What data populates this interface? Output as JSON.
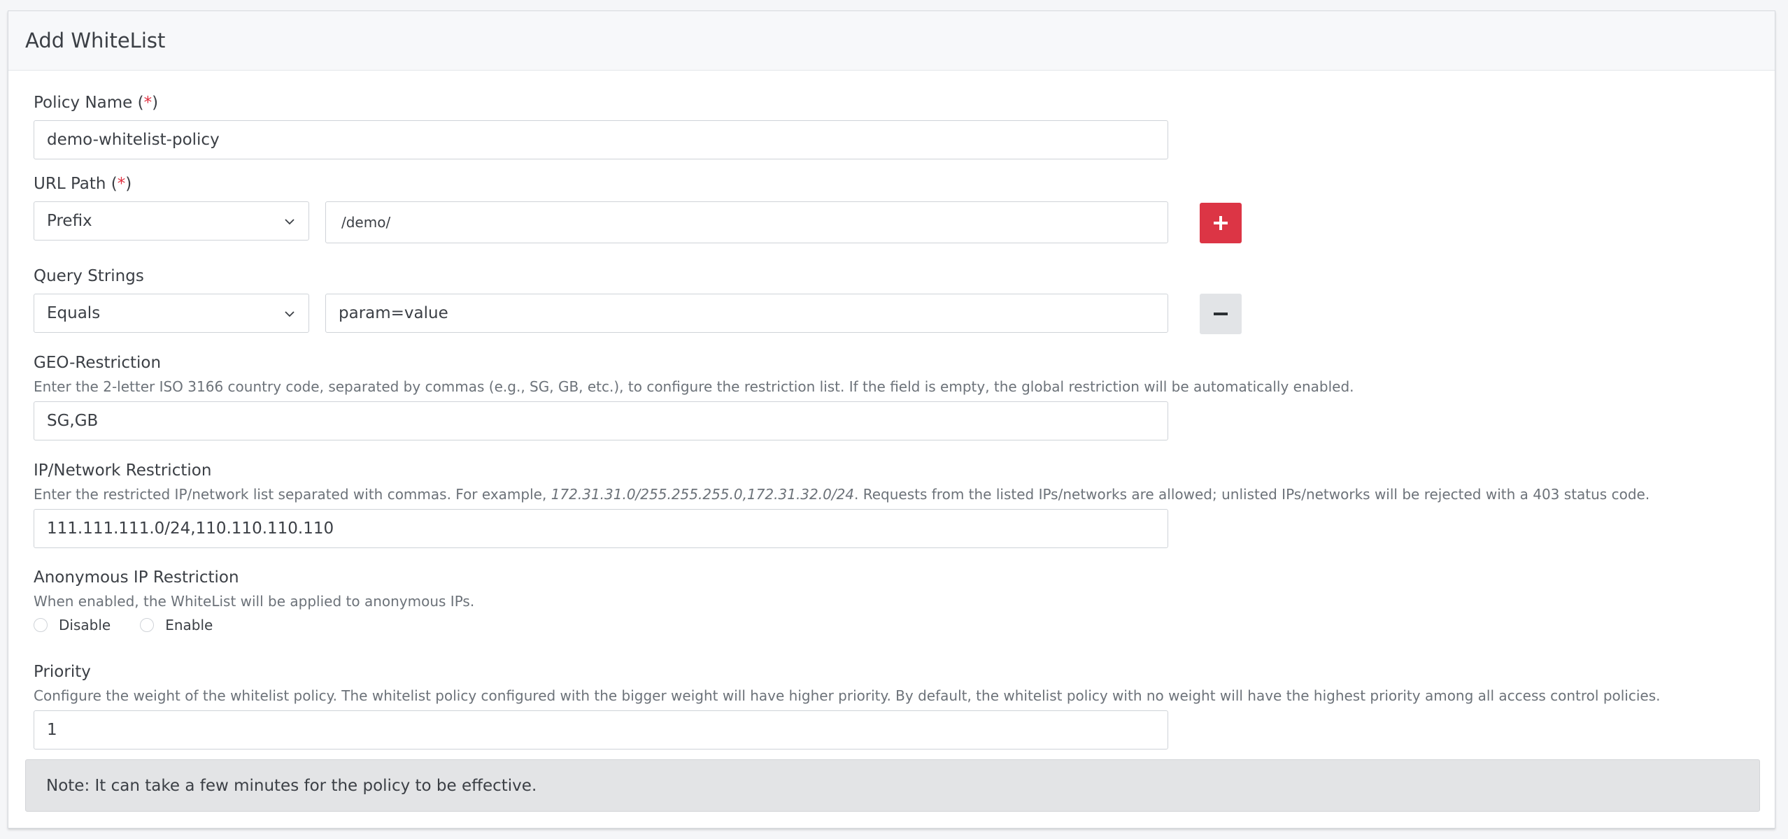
{
  "header": {
    "title": "Add WhiteList"
  },
  "required_mark": "*",
  "policy_name": {
    "label": "Policy Name (",
    "label_end": ")",
    "value": "demo-whitelist-policy"
  },
  "url_path": {
    "label": "URL Path (",
    "label_end": ")",
    "match_type": "Prefix",
    "value": "/demo/",
    "add_icon": "plus-icon"
  },
  "query_strings": {
    "label": "Query Strings",
    "match_type": "Equals",
    "value": "param=value",
    "remove_icon": "minus-icon"
  },
  "geo_restriction": {
    "label": "GEO-Restriction",
    "hint": "Enter the 2-letter ISO 3166 country code, separated by commas (e.g., SG, GB, etc.), to configure the restriction list. If the field is empty, the global restriction will be automatically enabled.",
    "value": "SG,GB"
  },
  "ip_restriction": {
    "label": "IP/Network Restriction",
    "hint_before": "Enter the restricted IP/network list separated with commas. For example, ",
    "hint_example": "172.31.31.0/255.255.255.0,172.31.32.0/24",
    "hint_after": ". Requests from the listed IPs/networks are allowed; unlisted IPs/networks will be rejected with a 403 status code.",
    "value": "111.111.111.0/24,110.110.110.110"
  },
  "anonymous_ip": {
    "label": "Anonymous IP Restriction",
    "hint": "When enabled, the WhiteList will be applied to anonymous IPs.",
    "option_disable": "Disable",
    "option_enable": "Enable"
  },
  "priority": {
    "label": "Priority",
    "hint": "Configure the weight of the whitelist policy. The whitelist policy configured with the bigger weight will have higher priority. By default, the whitelist policy with no weight will have the highest priority among all access control policies.",
    "value": "1"
  },
  "note": "Note: It can take a few minutes for the policy to be effective.",
  "colors": {
    "accent": "#dc3545",
    "required": "#e03040",
    "note_bg": "#e3e4e6"
  }
}
